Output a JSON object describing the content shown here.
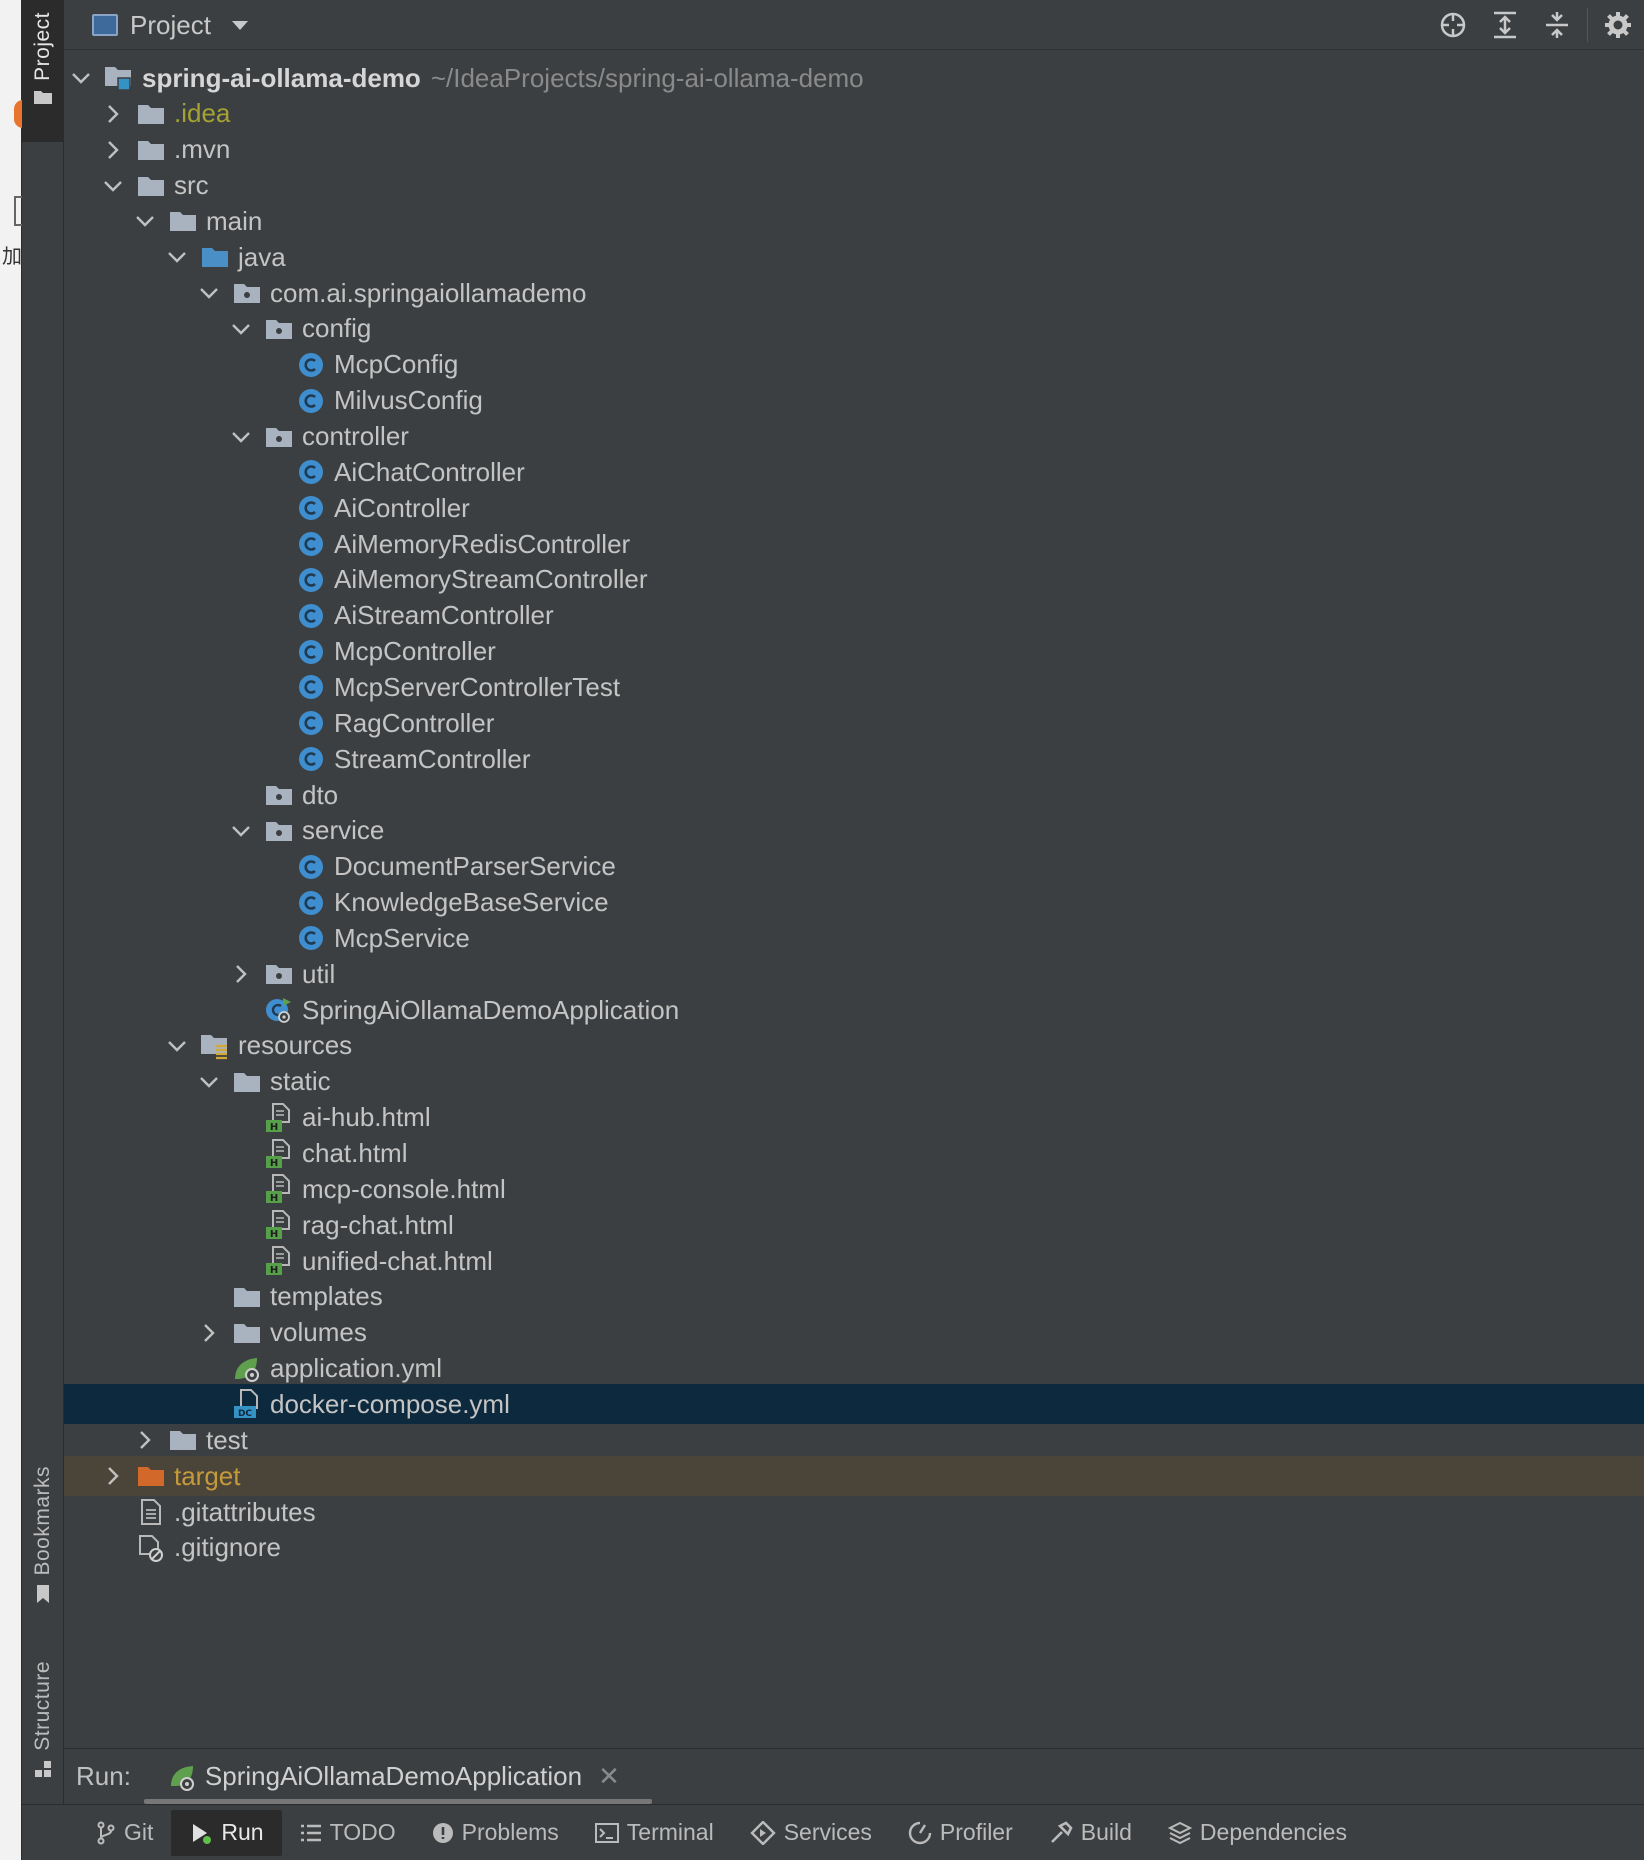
{
  "header": {
    "title": "Project"
  },
  "stripe": {
    "project": "Project",
    "bookmarks": "Bookmarks",
    "structure": "Structure"
  },
  "sliver": {
    "char": "加"
  },
  "colors": {
    "background": "#3c3f41",
    "selection": "#0d293e",
    "excluded": "#4b4539",
    "class_icon": "#3f8ecf",
    "folder": "#a9b3bf",
    "source_folder": "#4a8fc5",
    "excluded_folder": "#d2692a"
  },
  "tree": {
    "items": [
      {
        "label": "spring-ai-ollama-demo",
        "path": "~/IdeaProjects/spring-ai-ollama-demo",
        "icon": "module-folder-icon",
        "chevron": "expanded",
        "style": "bold"
      },
      {
        "label": ".idea",
        "icon": "folder-icon",
        "chevron": "collapsed",
        "style": "olive"
      },
      {
        "label": ".mvn",
        "icon": "folder-icon",
        "chevron": "collapsed"
      },
      {
        "label": "src",
        "icon": "folder-icon",
        "chevron": "expanded"
      },
      {
        "label": "main",
        "icon": "folder-icon",
        "chevron": "expanded"
      },
      {
        "label": "java",
        "icon": "source-folder-icon",
        "chevron": "expanded"
      },
      {
        "label": "com.ai.springaiollamademo",
        "icon": "package-icon",
        "chevron": "expanded"
      },
      {
        "label": "config",
        "icon": "package-icon",
        "chevron": "expanded"
      },
      {
        "label": "McpConfig",
        "icon": "class-icon"
      },
      {
        "label": "MilvusConfig",
        "icon": "class-icon"
      },
      {
        "label": "controller",
        "icon": "package-icon",
        "chevron": "expanded"
      },
      {
        "label": "AiChatController",
        "icon": "class-icon"
      },
      {
        "label": "AiController",
        "icon": "class-icon"
      },
      {
        "label": "AiMemoryRedisController",
        "icon": "class-icon"
      },
      {
        "label": "AiMemoryStreamController",
        "icon": "class-icon"
      },
      {
        "label": "AiStreamController",
        "icon": "class-icon"
      },
      {
        "label": "McpController",
        "icon": "class-icon"
      },
      {
        "label": "McpServerControllerTest",
        "icon": "class-icon"
      },
      {
        "label": "RagController",
        "icon": "class-icon"
      },
      {
        "label": "StreamController",
        "icon": "class-icon"
      },
      {
        "label": "dto",
        "icon": "package-icon"
      },
      {
        "label": "service",
        "icon": "package-icon",
        "chevron": "expanded"
      },
      {
        "label": "DocumentParserService",
        "icon": "class-icon"
      },
      {
        "label": "KnowledgeBaseService",
        "icon": "class-icon"
      },
      {
        "label": "McpService",
        "icon": "class-icon"
      },
      {
        "label": "util",
        "icon": "package-icon",
        "chevron": "collapsed"
      },
      {
        "label": "SpringAiOllamaDemoApplication",
        "icon": "spring-boot-class-icon"
      },
      {
        "label": "resources",
        "icon": "resources-folder-icon",
        "chevron": "expanded"
      },
      {
        "label": "static",
        "icon": "folder-icon",
        "chevron": "expanded"
      },
      {
        "label": "ai-hub.html",
        "icon": "html-file-icon"
      },
      {
        "label": "chat.html",
        "icon": "html-file-icon"
      },
      {
        "label": "mcp-console.html",
        "icon": "html-file-icon"
      },
      {
        "label": "rag-chat.html",
        "icon": "html-file-icon"
      },
      {
        "label": "unified-chat.html",
        "icon": "html-file-icon"
      },
      {
        "label": "templates",
        "icon": "folder-icon"
      },
      {
        "label": "volumes",
        "icon": "folder-icon",
        "chevron": "collapsed"
      },
      {
        "label": "application.yml",
        "icon": "spring-yml-icon"
      },
      {
        "label": "docker-compose.yml",
        "icon": "docker-compose-icon",
        "selected": true
      },
      {
        "label": "test",
        "icon": "folder-icon",
        "chevron": "collapsed"
      },
      {
        "label": "target",
        "icon": "excluded-folder-icon",
        "chevron": "collapsed",
        "style": "orange",
        "excluded": true
      },
      {
        "label": ".gitattributes",
        "icon": "text-file-icon"
      },
      {
        "label": ".gitignore",
        "icon": "ignore-file-icon"
      }
    ]
  },
  "run": {
    "label": "Run:",
    "config_name": "SpringAiOllamaDemoApplication"
  },
  "bottom_tabs": [
    {
      "label": "Git",
      "icon": "git-branch-icon"
    },
    {
      "label": "Run",
      "icon": "run-icon",
      "active": true
    },
    {
      "label": "TODO",
      "icon": "todo-list-icon"
    },
    {
      "label": "Problems",
      "icon": "problems-icon"
    },
    {
      "label": "Terminal",
      "icon": "terminal-icon"
    },
    {
      "label": "Services",
      "icon": "services-icon"
    },
    {
      "label": "Profiler",
      "icon": "profiler-icon"
    },
    {
      "label": "Build",
      "icon": "hammer-icon"
    },
    {
      "label": "Dependencies",
      "icon": "dependencies-icon"
    }
  ]
}
